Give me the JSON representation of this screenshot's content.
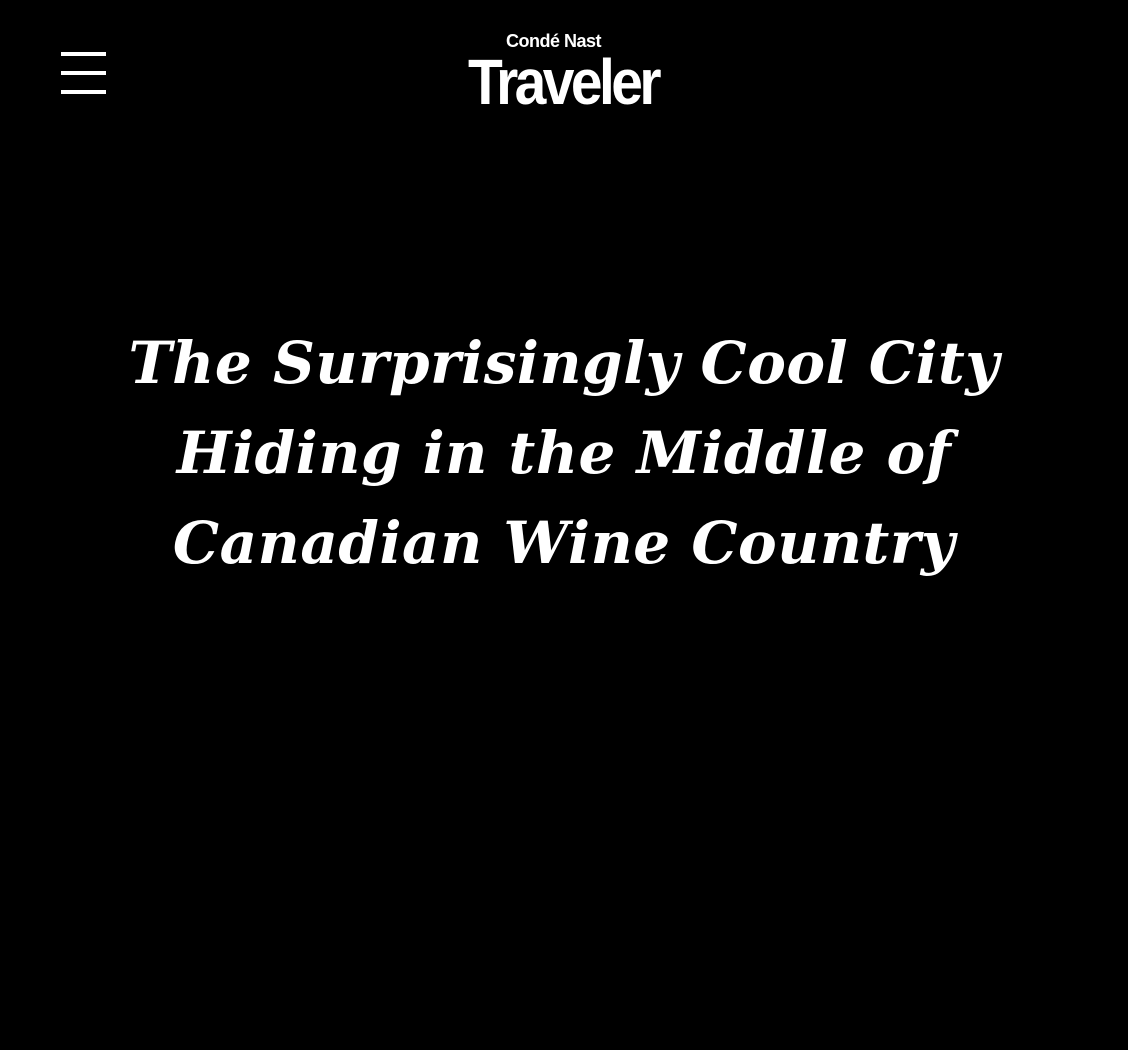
{
  "theme": {
    "background": "#000000",
    "foreground": "#ffffff"
  },
  "header": {
    "menu_icon": "hamburger-menu-icon",
    "logo": {
      "small_text": "Condé Nast",
      "large_text": "Traveler"
    }
  },
  "article": {
    "headline": "The Surprisingly Cool City Hiding in the Middle of Canadian Wine Country"
  }
}
